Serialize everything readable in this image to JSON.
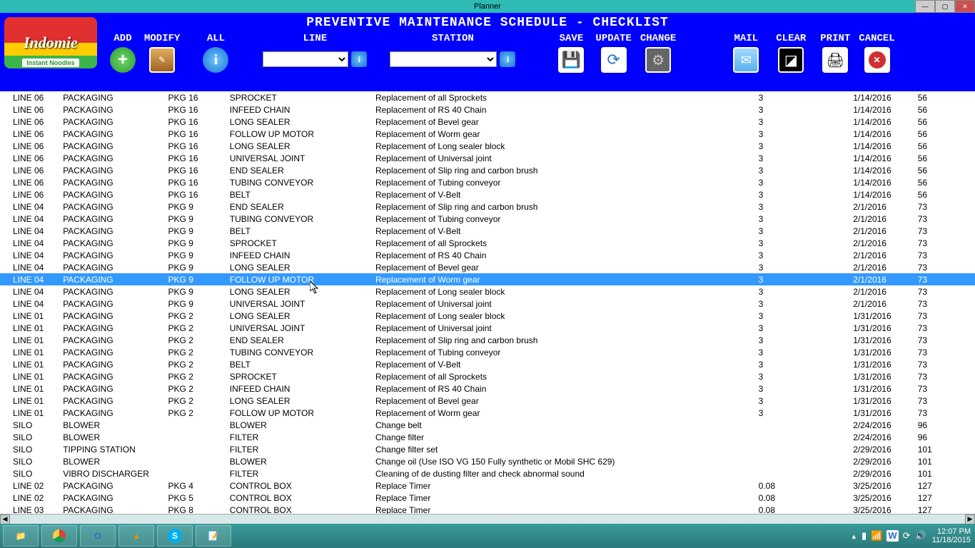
{
  "window": {
    "title": "Planner"
  },
  "logo": {
    "brand": "Indomie",
    "sub": "Instant Noodles"
  },
  "header": {
    "title": "PREVENTIVE MAINTENANCE SCHEDULE - CHECKLIST"
  },
  "toolbar": {
    "add": "ADD",
    "modify": "MODIFY",
    "all": "ALL",
    "line": "LINE",
    "station": "STATION",
    "save": "SAVE",
    "update": "UPDATE",
    "change": "CHANGE",
    "mail": "MAIL",
    "clear": "CLEAR",
    "print": "PRINT",
    "cancel": "CANCEL"
  },
  "selected_row_index": 15,
  "rows": [
    {
      "line": "LINE 06",
      "area": "PACKAGING",
      "pkg": "PKG 16",
      "comp": "SPROCKET",
      "desc": "Replacement of all Sprockets",
      "qty": "3",
      "date": "1/14/2016",
      "days": "56"
    },
    {
      "line": "LINE 06",
      "area": "PACKAGING",
      "pkg": "PKG 16",
      "comp": "INFEED CHAIN",
      "desc": "Replacement of RS 40 Chain",
      "qty": "3",
      "date": "1/14/2016",
      "days": "56"
    },
    {
      "line": "LINE 06",
      "area": "PACKAGING",
      "pkg": "PKG 16",
      "comp": "LONG SEALER",
      "desc": "Replacement of Bevel gear",
      "qty": "3",
      "date": "1/14/2016",
      "days": "56"
    },
    {
      "line": "LINE 06",
      "area": "PACKAGING",
      "pkg": "PKG 16",
      "comp": "FOLLOW UP MOTOR",
      "desc": "Replacement of Worm gear",
      "qty": "3",
      "date": "1/14/2016",
      "days": "56"
    },
    {
      "line": "LINE 06",
      "area": "PACKAGING",
      "pkg": "PKG 16",
      "comp": "LONG SEALER",
      "desc": "Replacement of Long sealer block",
      "qty": "3",
      "date": "1/14/2016",
      "days": "56"
    },
    {
      "line": "LINE 06",
      "area": "PACKAGING",
      "pkg": "PKG 16",
      "comp": "UNIVERSAL JOINT",
      "desc": "Replacement of Universal joint",
      "qty": "3",
      "date": "1/14/2016",
      "days": "56"
    },
    {
      "line": "LINE 06",
      "area": "PACKAGING",
      "pkg": "PKG 16",
      "comp": "END SEALER",
      "desc": "Replacement of Slip ring and carbon brush",
      "qty": "3",
      "date": "1/14/2016",
      "days": "56"
    },
    {
      "line": "LINE 06",
      "area": "PACKAGING",
      "pkg": "PKG 16",
      "comp": "TUBING CONVEYOR",
      "desc": "Replacement of Tubing conveyor",
      "qty": "3",
      "date": "1/14/2016",
      "days": "56"
    },
    {
      "line": "LINE 06",
      "area": "PACKAGING",
      "pkg": "PKG 16",
      "comp": "BELT",
      "desc": "Replacement of V-Belt",
      "qty": "3",
      "date": "1/14/2016",
      "days": "56"
    },
    {
      "line": "LINE 04",
      "area": "PACKAGING",
      "pkg": "PKG 9",
      "comp": "END SEALER",
      "desc": "Replacement of Slip ring and carbon brush",
      "qty": "3",
      "date": "2/1/2016",
      "days": "73"
    },
    {
      "line": "LINE 04",
      "area": "PACKAGING",
      "pkg": "PKG 9",
      "comp": "TUBING CONVEYOR",
      "desc": "Replacement of Tubing conveyor",
      "qty": "3",
      "date": "2/1/2016",
      "days": "73"
    },
    {
      "line": "LINE 04",
      "area": "PACKAGING",
      "pkg": "PKG 9",
      "comp": "BELT",
      "desc": "Replacement of V-Belt",
      "qty": "3",
      "date": "2/1/2016",
      "days": "73"
    },
    {
      "line": "LINE 04",
      "area": "PACKAGING",
      "pkg": "PKG 9",
      "comp": "SPROCKET",
      "desc": "Replacement of all Sprockets",
      "qty": "3",
      "date": "2/1/2016",
      "days": "73"
    },
    {
      "line": "LINE 04",
      "area": "PACKAGING",
      "pkg": "PKG 9",
      "comp": "INFEED CHAIN",
      "desc": "Replacement of RS 40 Chain",
      "qty": "3",
      "date": "2/1/2016",
      "days": "73"
    },
    {
      "line": "LINE 04",
      "area": "PACKAGING",
      "pkg": "PKG 9",
      "comp": "LONG SEALER",
      "desc": "Replacement of Bevel gear",
      "qty": "3",
      "date": "2/1/2016",
      "days": "73"
    },
    {
      "line": "LINE 04",
      "area": "PACKAGING",
      "pkg": "PKG 9",
      "comp": "FOLLOW UP MOTOR",
      "desc": "Replacement of Worm gear",
      "qty": "3",
      "date": "2/1/2016",
      "days": "73"
    },
    {
      "line": "LINE 04",
      "area": "PACKAGING",
      "pkg": "PKG 9",
      "comp": "LONG SEALER",
      "desc": "Replacement of Long sealer block",
      "qty": "3",
      "date": "2/1/2016",
      "days": "73"
    },
    {
      "line": "LINE 04",
      "area": "PACKAGING",
      "pkg": "PKG 9",
      "comp": "UNIVERSAL JOINT",
      "desc": "Replacement of Universal joint",
      "qty": "3",
      "date": "2/1/2016",
      "days": "73"
    },
    {
      "line": "LINE 01",
      "area": "PACKAGING",
      "pkg": "PKG 2",
      "comp": "LONG SEALER",
      "desc": "Replacement of Long sealer block",
      "qty": "3",
      "date": "1/31/2016",
      "days": "73"
    },
    {
      "line": "LINE 01",
      "area": "PACKAGING",
      "pkg": "PKG 2",
      "comp": "UNIVERSAL JOINT",
      "desc": "Replacement of Universal joint",
      "qty": "3",
      "date": "1/31/2016",
      "days": "73"
    },
    {
      "line": "LINE 01",
      "area": "PACKAGING",
      "pkg": "PKG 2",
      "comp": "END SEALER",
      "desc": "Replacement of Slip ring and carbon brush",
      "qty": "3",
      "date": "1/31/2016",
      "days": "73"
    },
    {
      "line": "LINE 01",
      "area": "PACKAGING",
      "pkg": "PKG 2",
      "comp": "TUBING CONVEYOR",
      "desc": "Replacement of Tubing conveyor",
      "qty": "3",
      "date": "1/31/2016",
      "days": "73"
    },
    {
      "line": "LINE 01",
      "area": "PACKAGING",
      "pkg": "PKG 2",
      "comp": "BELT",
      "desc": "Replacement of V-Belt",
      "qty": "3",
      "date": "1/31/2016",
      "days": "73"
    },
    {
      "line": "LINE 01",
      "area": "PACKAGING",
      "pkg": "PKG 2",
      "comp": "SPROCKET",
      "desc": "Replacement of all Sprockets",
      "qty": "3",
      "date": "1/31/2016",
      "days": "73"
    },
    {
      "line": "LINE 01",
      "area": "PACKAGING",
      "pkg": "PKG 2",
      "comp": "INFEED CHAIN",
      "desc": "Replacement of RS 40 Chain",
      "qty": "3",
      "date": "1/31/2016",
      "days": "73"
    },
    {
      "line": "LINE 01",
      "area": "PACKAGING",
      "pkg": "PKG 2",
      "comp": "LONG SEALER",
      "desc": "Replacement of Bevel gear",
      "qty": "3",
      "date": "1/31/2016",
      "days": "73"
    },
    {
      "line": "LINE 01",
      "area": "PACKAGING",
      "pkg": "PKG 2",
      "comp": "FOLLOW UP MOTOR",
      "desc": "Replacement of Worm gear",
      "qty": "3",
      "date": "1/31/2016",
      "days": "73"
    },
    {
      "line": "SILO",
      "area": "BLOWER",
      "pkg": "",
      "comp": "BLOWER",
      "desc": "Change belt",
      "qty": "",
      "date": "2/24/2016",
      "days": "96"
    },
    {
      "line": "SILO",
      "area": "BLOWER",
      "pkg": "",
      "comp": "FILTER",
      "desc": "Change filter",
      "qty": "",
      "date": "2/24/2016",
      "days": "96"
    },
    {
      "line": "SILO",
      "area": "TIPPING STATION",
      "pkg": "",
      "comp": "FILTER",
      "desc": "Change filter set",
      "qty": "",
      "date": "2/29/2016",
      "days": "101"
    },
    {
      "line": "SILO",
      "area": "BLOWER",
      "pkg": "",
      "comp": "BLOWER",
      "desc": "Change oil (Use ISO VG 150 Fully synthetic or Mobil SHC 629)",
      "qty": "",
      "date": "2/29/2016",
      "days": "101"
    },
    {
      "line": "SILO",
      "area": "VIBRO DISCHARGER",
      "pkg": "",
      "comp": "FILTER",
      "desc": "Cleaning of de dusting filter and check abnormal sound",
      "qty": "",
      "date": "2/29/2016",
      "days": "101"
    },
    {
      "line": "LINE 02",
      "area": "PACKAGING",
      "pkg": "PKG 4",
      "comp": "CONTROL BOX",
      "desc": "Replace Timer",
      "qty": "0.08",
      "date": "3/25/2016",
      "days": "127"
    },
    {
      "line": "LINE 02",
      "area": "PACKAGING",
      "pkg": "PKG 5",
      "comp": "CONTROL BOX",
      "desc": "Replace Timer",
      "qty": "0.08",
      "date": "3/25/2016",
      "days": "127"
    },
    {
      "line": "LINE 03",
      "area": "PACKAGING",
      "pkg": "PKG 8",
      "comp": "CONTROL BOX",
      "desc": "Replace Timer",
      "qty": "0.08",
      "date": "3/25/2016",
      "days": "127"
    }
  ],
  "tray": {
    "time": "12:07 PM",
    "date": "11/18/2015"
  }
}
